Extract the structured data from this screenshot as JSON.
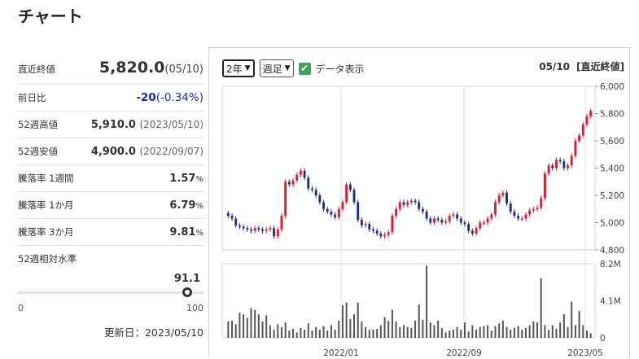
{
  "page_title": "チャート",
  "info": {
    "close": {
      "label": "直近終値",
      "value": "5,820.0",
      "date": "(05/10)"
    },
    "change": {
      "label": "前日比",
      "value": "-20",
      "pct": "(-0.34%)"
    },
    "high52": {
      "label": "52週高値",
      "value": "5,910.0",
      "date": "(2023/05/10)"
    },
    "low52": {
      "label": "52週安値",
      "value": "4,900.0",
      "date": "(2022/09/07)"
    },
    "r1w": {
      "label": "騰落率 1週間",
      "value": "1.57",
      "unit": "%"
    },
    "r1m": {
      "label": "騰落率 1か月",
      "value": "6.79",
      "unit": "%"
    },
    "r3m": {
      "label": "騰落率 3か月",
      "value": "9.81",
      "unit": "%"
    },
    "position": {
      "label": "52週相対水準",
      "value": "91.1",
      "level": 91.1,
      "min": "0",
      "max": "100"
    },
    "updated": "更新日：2023/05/10"
  },
  "chart": {
    "period": "2年",
    "interval": "週足",
    "data_display_label": "データ表示",
    "data_display_checked": true,
    "header_date": "05/10",
    "header_label": "[直近終値]"
  },
  "colors": {
    "up": "#e8192c",
    "down": "#1f2f8a",
    "volume": "#555555",
    "accent": "#3aa757"
  },
  "chart_data": {
    "type": "candlestick",
    "price_axis": {
      "ticks": [
        "6,000",
        "5,800",
        "5,600",
        "5,400",
        "5,200",
        "5,000",
        "4,800"
      ],
      "range": [
        4800,
        6000
      ]
    },
    "volume_axis": {
      "ticks": [
        "8.2M",
        "4.1M",
        "0"
      ],
      "range": [
        0,
        8.2
      ]
    },
    "x_ticks": [
      "2022/01",
      "2022/09",
      "2023/05"
    ],
    "price": [
      5050,
      5030,
      4980,
      4970,
      4960,
      4950,
      4940,
      4960,
      4950,
      4940,
      4950,
      4960,
      4900,
      4950,
      5050,
      5300,
      5280,
      5310,
      5350,
      5380,
      5330,
      5250,
      5240,
      5200,
      5150,
      5100,
      5080,
      5060,
      5040,
      5100,
      5150,
      5280,
      5240,
      5150,
      5020,
      4980,
      4990,
      4950,
      4940,
      4920,
      4900,
      4910,
      4930,
      5050,
      5100,
      5150,
      5130,
      5150,
      5160,
      5150,
      5100,
      5080,
      5030,
      5000,
      5030,
      5020,
      5000,
      5010,
      5050,
      5060,
      5030,
      5000,
      4990,
      4940,
      4920,
      4960,
      5000,
      5000,
      5030,
      5060,
      5150,
      5200,
      5220,
      5140,
      5080,
      5050,
      5030,
      5030,
      5060,
      5090,
      5100,
      5110,
      5180,
      5360,
      5420,
      5400,
      5460,
      5450,
      5400,
      5420,
      5490,
      5600,
      5640,
      5720,
      5780,
      5820
    ],
    "volume_millions": [
      1.8,
      1.9,
      1.5,
      2.8,
      2.6,
      2.2,
      3.3,
      3.1,
      2.6,
      1.8,
      2.5,
      1.4,
      0.9,
      1.5,
      1.2,
      1.7,
      0.8,
      1.0,
      0.6,
      1.1,
      0.9,
      1.6,
      0.8,
      1.2,
      0.9,
      1.3,
      0.8,
      1.4,
      0.9,
      1.9,
      3.6,
      3.9,
      2.1,
      2.6,
      3.9,
      1.8,
      1.2,
      0.9,
      0.9,
      1.0,
      1.4,
      2.3,
      1.9,
      3.1,
      1.8,
      1.2,
      1.4,
      1.2,
      1.1,
      1.9,
      3.7,
      2.0,
      8.0,
      1.7,
      1.4,
      1.9,
      1.1,
      0.6,
      0.8,
      0.9,
      1.2,
      0.9,
      1.7,
      0.7,
      1.4,
      0.9,
      1.2,
      1.3,
      1.4,
      0.8,
      1.3,
      1.6,
      1.9,
      1.2,
      0.9,
      1.1,
      1.3,
      0.9,
      1.1,
      1.4,
      1.8,
      1.7,
      6.6,
      1.4,
      0.9,
      1.4,
      1.0,
      1.7,
      2.6,
      1.2,
      4.0,
      1.4,
      3.0,
      1.4,
      0.8,
      0.5
    ]
  }
}
